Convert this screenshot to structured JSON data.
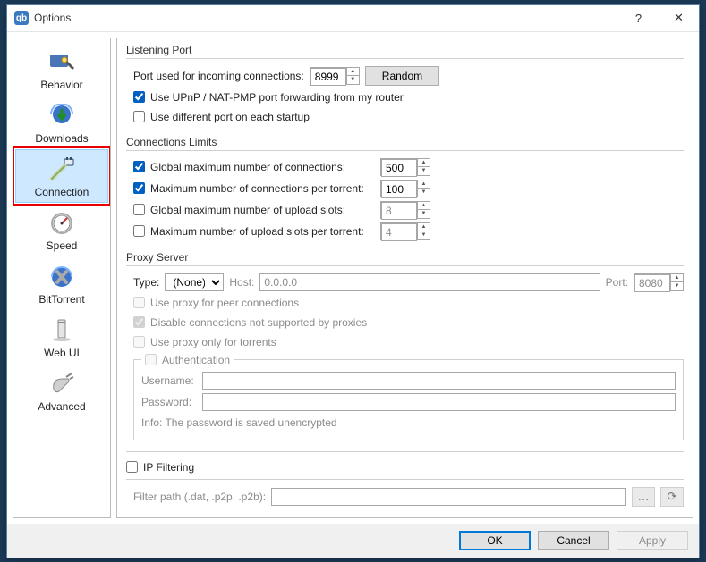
{
  "window": {
    "title": "Options",
    "help_glyph": "?",
    "close_glyph": "✕"
  },
  "sidebar": {
    "items": [
      {
        "id": "behavior",
        "label": "Behavior"
      },
      {
        "id": "downloads",
        "label": "Downloads"
      },
      {
        "id": "connection",
        "label": "Connection",
        "selected": true,
        "highlighted": true
      },
      {
        "id": "speed",
        "label": "Speed"
      },
      {
        "id": "bittorrent",
        "label": "BitTorrent"
      },
      {
        "id": "webui",
        "label": "Web UI"
      },
      {
        "id": "advanced",
        "label": "Advanced"
      }
    ]
  },
  "listening_port": {
    "title": "Listening Port",
    "port_label": "Port used for incoming connections:",
    "port_value": "8999",
    "random_button": "Random",
    "upnp_checked": true,
    "upnp_label": "Use UPnP / NAT-PMP port forwarding from my router",
    "diffport_checked": false,
    "diffport_label": "Use different port on each startup"
  },
  "conn_limits": {
    "title": "Connections Limits",
    "rows": [
      {
        "checked": true,
        "label": "Global maximum number of connections:",
        "value": "500",
        "enabled": true
      },
      {
        "checked": true,
        "label": "Maximum number of connections per torrent:",
        "value": "100",
        "enabled": true
      },
      {
        "checked": false,
        "label": "Global maximum number of upload slots:",
        "value": "8",
        "enabled": false
      },
      {
        "checked": false,
        "label": "Maximum number of upload slots per torrent:",
        "value": "4",
        "enabled": false
      }
    ]
  },
  "proxy": {
    "title": "Proxy Server",
    "type_label": "Type:",
    "type_value": "(None)",
    "host_label": "Host:",
    "host_value": "0.0.0.0",
    "port_label": "Port:",
    "port_value": "8080",
    "peer_label": "Use proxy for peer connections",
    "disable_unsup_label": "Disable connections not supported by proxies",
    "disable_unsup_checked": true,
    "only_torrents_label": "Use proxy only for torrents",
    "auth_label": "Authentication",
    "username_label": "Username:",
    "username_value": "",
    "password_label": "Password:",
    "password_value": "",
    "info": "Info: The password is saved unencrypted"
  },
  "ipfilter": {
    "title": "IP Filtering",
    "checked": false,
    "path_label": "Filter path (.dat, .p2p, .p2b):",
    "path_value": ""
  },
  "footer": {
    "ok": "OK",
    "cancel": "Cancel",
    "apply": "Apply"
  }
}
